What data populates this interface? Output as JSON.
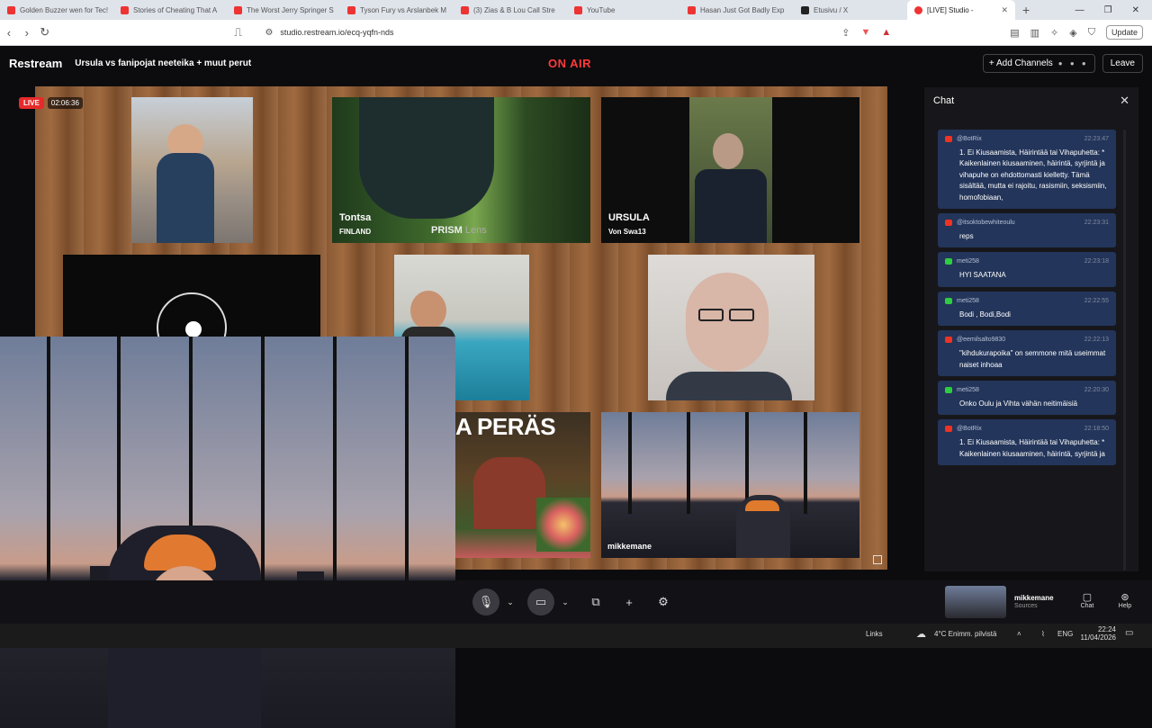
{
  "browser": {
    "tabs": [
      {
        "title": "Golden Buzzer wen for Tec!",
        "color": "#e33"
      },
      {
        "title": "Stories of Cheating That A",
        "color": "#e33"
      },
      {
        "title": "The Worst Jerry Springer S",
        "color": "#e33"
      },
      {
        "title": "Tyson Fury vs Arslanbek M",
        "color": "#e33"
      },
      {
        "title": "(3) Zias & B Lou Call Stre",
        "color": "#e33"
      },
      {
        "title": "YouTube",
        "color": "#e33"
      },
      {
        "title": "Hasan Just Got Badly Exp",
        "color": "#e33"
      },
      {
        "title": "Etusivu / X",
        "color": "#222"
      }
    ],
    "active_tab": "[LIVE] Studio -",
    "url": "studio.restream.io/ecq-yqfn-nds",
    "update_label": "Update"
  },
  "header": {
    "logo": "Restream",
    "title": "Ursula vs fanipojat neeteika + muut perut",
    "on_air": "ON AIR",
    "add_channels": "+ Add Channels",
    "leave": "Leave"
  },
  "stage": {
    "live_label": "LIVE",
    "timer": "02:06:36",
    "tiles": {
      "tontsa_name": "Tontsa",
      "tontsa_sub": "FINLAND",
      "prism": "PRISM",
      "prism_lens": "Lens",
      "ursula_name": "URSULA",
      "ursula_sub": "Von Swa13",
      "headline": "A PERÄS",
      "mikkemane": "mikkemane"
    }
  },
  "toolbar": {
    "source_name": "mikkemane",
    "source_sub": "Sources",
    "chat_label": "Chat",
    "help_label": "Help"
  },
  "chat": {
    "title": "Chat",
    "messages": [
      {
        "platform": "yt",
        "user": "@BotRix",
        "time": "22:23:47",
        "text": "1. Ei Kiusaamista, Häirintää tai Vihapuhetta: * Kaikenlainen kiusaaminen, häirintä, syrjintä ja vihapuhe on ehdottomasti kielletty. Tämä sisältää, mutta ei rajoitu, rasismiin, seksismiin, homofobiaan,"
      },
      {
        "platform": "yt",
        "user": "@itsoktobewhiteoulu",
        "time": "22:23:31",
        "text": "reps"
      },
      {
        "platform": "kick",
        "user": "meti258",
        "time": "22:23:18",
        "text": "HYI SAATANA"
      },
      {
        "platform": "kick",
        "user": "meti258",
        "time": "22:22:55",
        "text": "Bodi , Bodi,Bodi"
      },
      {
        "platform": "yt",
        "user": "@eemilsalto9830",
        "time": "22:22:13",
        "text": "\"kihdukurapoika\" on semmone mitä useimmat naiset inhoaa"
      },
      {
        "platform": "kick",
        "user": "meti258",
        "time": "22:20:30",
        "text": "Onko Oulu ja Vihta vähän neitimäisiä"
      },
      {
        "platform": "yt",
        "user": "@BotRix",
        "time": "22:18:50",
        "text": "1. Ei Kiusaamista, Häirintää tai Vihapuhetta: * Kaikenlainen kiusaaminen, häirintä, syrjintä ja"
      }
    ]
  },
  "taskbar": {
    "links": "Links",
    "weather": "4°C  Enimm. pilvistä",
    "lang": "ENG",
    "time": "22:24",
    "date": "11/04/2026"
  }
}
